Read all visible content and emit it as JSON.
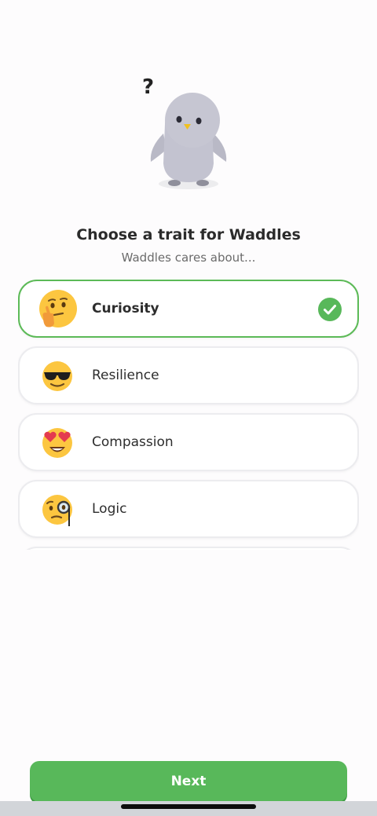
{
  "header": {
    "title": "Choose a trait for Waddles",
    "subtitle": "Waddles cares about...",
    "mascot_icon": "penguin-thinking",
    "question_mark": "?"
  },
  "options": [
    {
      "label": "Curiosity",
      "icon": "thinking-face-emoji",
      "selected": true
    },
    {
      "label": "Resilience",
      "icon": "sunglasses-face-emoji",
      "selected": false
    },
    {
      "label": "Compassion",
      "icon": "heart-eyes-face-emoji",
      "selected": false
    },
    {
      "label": "Logic",
      "icon": "monocle-face-emoji",
      "selected": false
    }
  ],
  "footer": {
    "next_label": "Next"
  },
  "colors": {
    "accent": "#58b85a",
    "selected_border": "#5cba57",
    "background": "#fdfcfd"
  }
}
